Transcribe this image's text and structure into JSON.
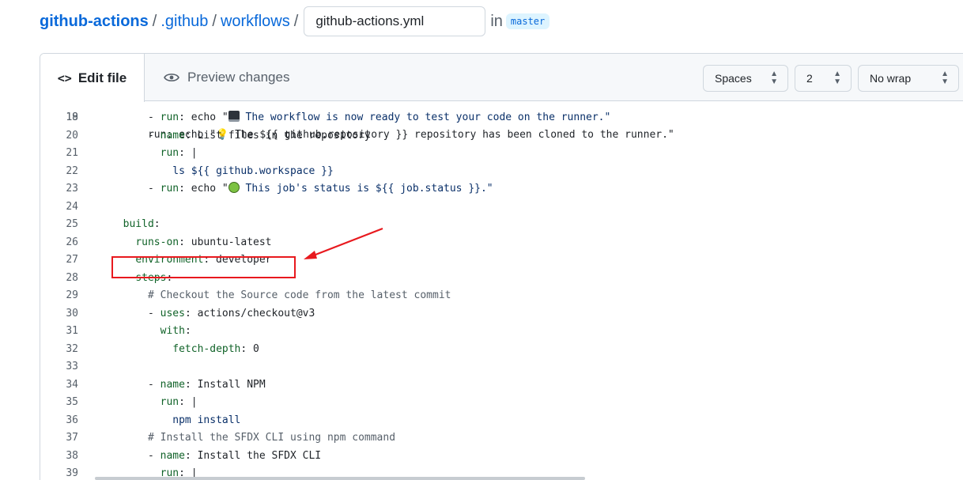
{
  "breadcrumb": {
    "repo": "github-actions",
    "segments": [
      ".github",
      "workflows"
    ],
    "separator": "/",
    "filename": "github-actions.yml",
    "in_label": "in",
    "branch": "master"
  },
  "toolbar": {
    "edit_tab": {
      "icon": "code-icon",
      "icon_glyph": "<>",
      "label": "Edit file"
    },
    "preview_tab": {
      "icon": "eye-icon",
      "label": "Preview changes"
    },
    "indent_mode": "Spaces",
    "indent_size": "2",
    "wrap_mode": "No wrap"
  },
  "code": {
    "partial_top": "      run: echo \"💡 The ${{ github.repository }} repository has been cloned to the runner.\"",
    "lines": [
      {
        "n": "19",
        "parts": [
          [
            "",
            "      - "
          ],
          [
            "k",
            "run"
          ],
          [
            "",
            ": echo \""
          ],
          [
            "emoji-monitor",
            ""
          ],
          [
            "s",
            " The workflow is now ready to test your code on the runner.\""
          ]
        ]
      },
      {
        "n": "20",
        "parts": [
          [
            "",
            "      - "
          ],
          [
            "k",
            "name"
          ],
          [
            "",
            ": List files in the repository"
          ]
        ]
      },
      {
        "n": "21",
        "parts": [
          [
            "",
            "        "
          ],
          [
            "k",
            "run"
          ],
          [
            "",
            ": |"
          ]
        ]
      },
      {
        "n": "22",
        "parts": [
          [
            "",
            "          "
          ],
          [
            "s",
            "ls ${{ github.workspace }}"
          ]
        ]
      },
      {
        "n": "23",
        "parts": [
          [
            "",
            "      - "
          ],
          [
            "k",
            "run"
          ],
          [
            "",
            ": echo \""
          ],
          [
            "emoji-apple",
            ""
          ],
          [
            "s",
            " This job's status is ${{ job.status }}.\""
          ]
        ]
      },
      {
        "n": "24",
        "parts": []
      },
      {
        "n": "25",
        "parts": [
          [
            "",
            "  "
          ],
          [
            "k",
            "build"
          ],
          [
            "",
            ":"
          ]
        ]
      },
      {
        "n": "26",
        "parts": [
          [
            "",
            "    "
          ],
          [
            "k",
            "runs-on"
          ],
          [
            "",
            ": ubuntu-latest"
          ]
        ]
      },
      {
        "n": "27",
        "parts": [
          [
            "",
            "    "
          ],
          [
            "k",
            "environment"
          ],
          [
            "",
            ": developer"
          ]
        ]
      },
      {
        "n": "28",
        "parts": [
          [
            "",
            "    "
          ],
          [
            "k",
            "steps"
          ],
          [
            "",
            ":"
          ]
        ]
      },
      {
        "n": "29",
        "parts": [
          [
            "",
            "      "
          ],
          [
            "c",
            "# Checkout the Source code from the latest commit"
          ]
        ]
      },
      {
        "n": "30",
        "parts": [
          [
            "",
            "      - "
          ],
          [
            "k",
            "uses"
          ],
          [
            "",
            ": actions/checkout@v3"
          ]
        ]
      },
      {
        "n": "31",
        "parts": [
          [
            "",
            "        "
          ],
          [
            "k",
            "with"
          ],
          [
            "",
            ":"
          ]
        ]
      },
      {
        "n": "32",
        "parts": [
          [
            "",
            "          "
          ],
          [
            "k",
            "fetch-depth"
          ],
          [
            "",
            ": 0"
          ]
        ]
      },
      {
        "n": "33",
        "parts": []
      },
      {
        "n": "34",
        "parts": [
          [
            "",
            "      - "
          ],
          [
            "k",
            "name"
          ],
          [
            "",
            ": Install NPM"
          ]
        ]
      },
      {
        "n": "35",
        "parts": [
          [
            "",
            "        "
          ],
          [
            "k",
            "run"
          ],
          [
            "",
            ": |"
          ]
        ]
      },
      {
        "n": "36",
        "parts": [
          [
            "",
            "          "
          ],
          [
            "s",
            "npm install"
          ]
        ]
      },
      {
        "n": "37",
        "parts": [
          [
            "",
            "      "
          ],
          [
            "c",
            "# Install the SFDX CLI using npm command"
          ]
        ]
      },
      {
        "n": "38",
        "parts": [
          [
            "",
            "      - "
          ],
          [
            "k",
            "name"
          ],
          [
            "",
            ": Install the SFDX CLI"
          ]
        ]
      },
      {
        "n": "39",
        "parts": [
          [
            "",
            "        "
          ],
          [
            "k",
            "run"
          ],
          [
            "",
            ": |"
          ]
        ]
      }
    ]
  },
  "annotation": {
    "color": "#e8191e",
    "highlighted_line": "27"
  },
  "colors": {
    "link": "#0969da",
    "key": "#116329",
    "string": "#0a3069",
    "comment": "#57606a"
  }
}
